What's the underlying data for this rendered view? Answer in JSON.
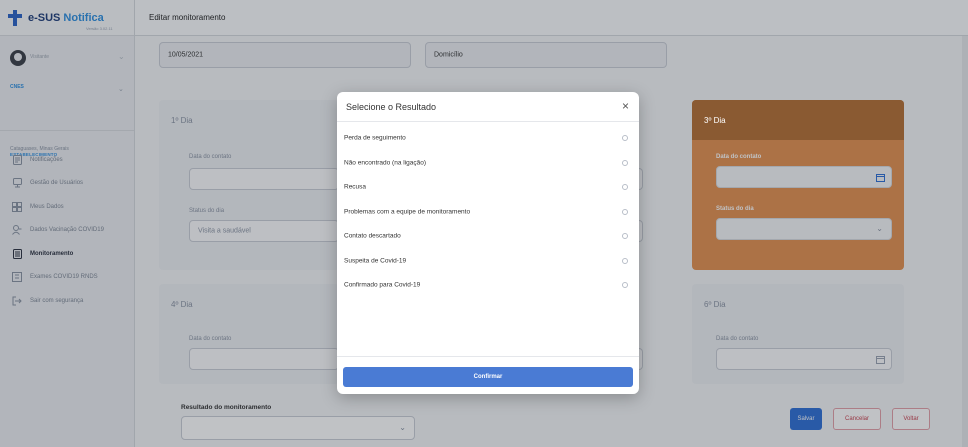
{
  "app": {
    "name_part1": "e-SUS",
    "name_part2": "Notifica",
    "version": "Versão 3.02.11"
  },
  "sidebar": {
    "user_name": "Visitante",
    "cnes_label": "CNES",
    "establishment_name": "Cataguases, Minas Gerais",
    "establishment_label": "ESTABELECIMENTO",
    "items": [
      {
        "label": "Notificações",
        "icon": "notifications-icon"
      },
      {
        "label": "Gestão de Usuários",
        "icon": "users-icon"
      },
      {
        "label": "Meus Dados",
        "icon": "profile-icon"
      },
      {
        "label": "Dados Vacinação COVID19",
        "icon": "vaccine-icon"
      },
      {
        "label": "Monitoramento",
        "icon": "monitor-icon",
        "active": true
      },
      {
        "label": "Exames COVID19 RNDS",
        "icon": "exams-icon"
      },
      {
        "label": "Sair com segurança",
        "icon": "logout-icon"
      }
    ]
  },
  "header": {
    "title": "Editar monitoramento"
  },
  "form": {
    "date_value": "10/05/2021",
    "location_value": "Domicílio",
    "day1_title": "1º Dia",
    "day3_title": "3º Dia",
    "day4_title": "4º Dia",
    "day6_title": "6º Dia",
    "contact_date_label": "Data do contato",
    "day_status_label": "Status do dia",
    "day1_status_value": "Visita a saudável",
    "result_label": "Resultado do monitoramento"
  },
  "buttons": {
    "save": "Salvar",
    "cancel": "Cancelar",
    "back": "Voltar"
  },
  "modal": {
    "title": "Selecione o Resultado",
    "close": "×",
    "options": [
      "Perda de seguimento",
      "Não encontrado (na ligação)",
      "Recusa",
      "Problemas com a equipe de monitoramento",
      "Contato descartado",
      "Suspeita de Covid-19",
      "Confirmado para Covid-19"
    ],
    "confirm": "Confirmar"
  }
}
